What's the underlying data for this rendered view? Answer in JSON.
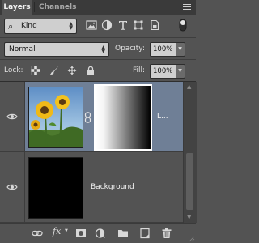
{
  "tabs": [
    {
      "label": "Layers",
      "active": true
    },
    {
      "label": "Channels",
      "active": false
    }
  ],
  "filter": {
    "kind_label": "Kind",
    "icons": [
      "image-filter-icon",
      "adjustment-filter-icon",
      "type-filter-icon",
      "shape-filter-icon",
      "smart-object-filter-icon",
      "filter-toggle-icon"
    ]
  },
  "blend": {
    "mode": "Normal",
    "opacity_label": "Opacity:",
    "opacity_value": "100%"
  },
  "lock": {
    "label": "Lock:",
    "icons": [
      "lock-transparent-pixels-icon",
      "lock-image-pixels-icon",
      "lock-position-icon",
      "lock-all-icon"
    ],
    "fill_label": "Fill:",
    "fill_value": "100%"
  },
  "layers": [
    {
      "name": "L...",
      "visible": true,
      "selected": true,
      "has_mask": true
    },
    {
      "name": "Background",
      "visible": true,
      "selected": false,
      "has_mask": false
    }
  ],
  "footer_icons": [
    "link-layers-icon",
    "fx-icon",
    "add-mask-icon",
    "new-adjustment-layer-icon",
    "new-group-icon",
    "new-layer-icon",
    "delete-layer-icon"
  ],
  "footer_fx_label": "fx",
  "colors": {
    "panel_bg": "#535353",
    "selected_row": "#6f7f96",
    "tab_bar": "#3a3a3a"
  }
}
